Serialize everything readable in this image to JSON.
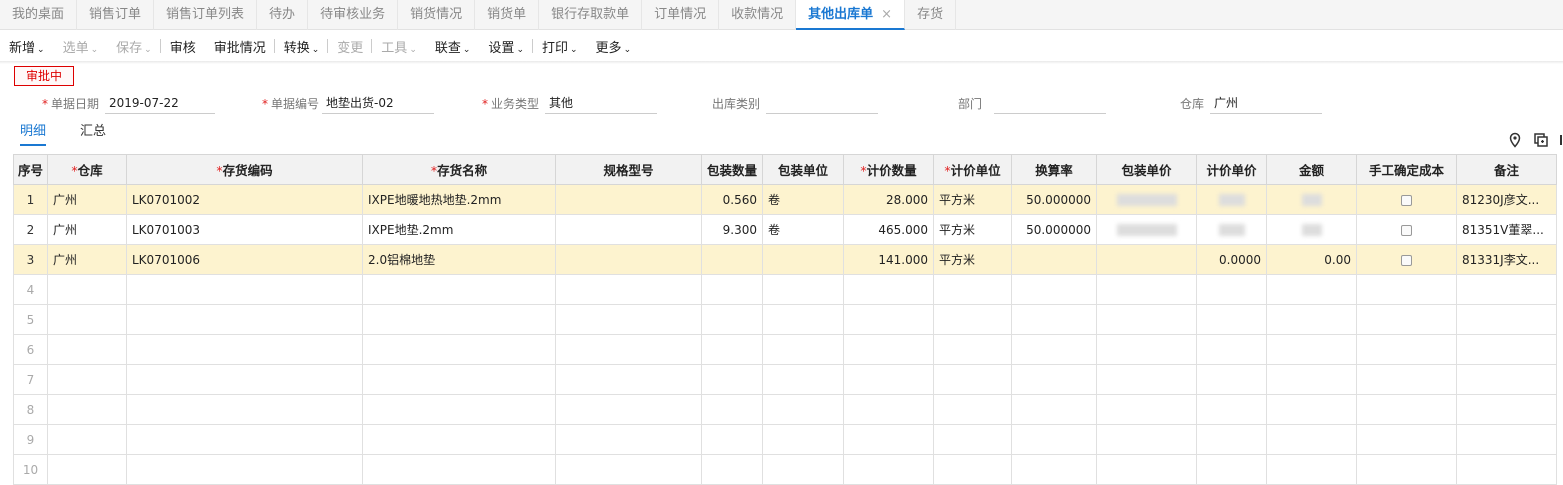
{
  "tabs": [
    {
      "label": "我的桌面"
    },
    {
      "label": "销售订单"
    },
    {
      "label": "销售订单列表"
    },
    {
      "label": "待办"
    },
    {
      "label": "待审核业务"
    },
    {
      "label": "销货情况"
    },
    {
      "label": "销货单"
    },
    {
      "label": "银行存取款单"
    },
    {
      "label": "订单情况"
    },
    {
      "label": "收款情况"
    },
    {
      "label": "其他出库单",
      "active": true,
      "close": "×"
    },
    {
      "label": "存货"
    }
  ],
  "toolbar": [
    {
      "label": "新增",
      "caret": "⌄",
      "disabled": false
    },
    {
      "label": "选单",
      "caret": "⌄",
      "disabled": true
    },
    {
      "label": "保存",
      "caret": "⌄",
      "disabled": true,
      "sep": true
    },
    {
      "label": "审核",
      "disabled": false
    },
    {
      "label": "审批情况",
      "disabled": false,
      "sep": true
    },
    {
      "label": "转换",
      "caret": "⌄",
      "disabled": false,
      "sep": true
    },
    {
      "label": "变更",
      "disabled": true,
      "sep": true
    },
    {
      "label": "工具",
      "caret": "⌄",
      "disabled": true
    },
    {
      "label": "联查",
      "caret": "⌄",
      "disabled": false
    },
    {
      "label": "设置",
      "caret": "⌄",
      "disabled": false,
      "sep": true
    },
    {
      "label": "打印",
      "caret": "⌄",
      "disabled": false
    },
    {
      "label": "更多",
      "caret": "⌄",
      "disabled": false
    }
  ],
  "status": "审批中",
  "form": {
    "date_label": "单据日期",
    "date_value": "2019-07-22",
    "code_label": "单据编号",
    "code_value": "地垫出货-02",
    "biz_label": "业务类型",
    "biz_value": "其他",
    "outtype_label": "出库类别",
    "outtype_value": "",
    "dept_label": "部门",
    "dept_value": "",
    "wh_label": "仓库",
    "wh_value": "广州"
  },
  "subtabs": {
    "detail": "明细",
    "summary": "汇总"
  },
  "table": {
    "headers": [
      "序号",
      "仓库",
      "存货编码",
      "存货名称",
      "规格型号",
      "包装数量",
      "包装单位",
      "计价数量",
      "计价单位",
      "换算率",
      "包装单价",
      "计价单价",
      "金额",
      "手工确定成本",
      "备注"
    ],
    "rows": [
      [
        "1",
        "广州",
        "LK0701002",
        "IXPE地暖地热地垫.2mm",
        "",
        "0.560",
        "卷",
        "28.000",
        "平方米",
        "50.000000",
        "",
        "",
        "",
        "",
        "81230J彦文..."
      ],
      [
        "2",
        "广州",
        "LK0701003",
        "IXPE地垫.2mm",
        "",
        "9.300",
        "卷",
        "465.000",
        "平方米",
        "50.000000",
        "",
        "",
        "",
        "",
        "81351V董翠..."
      ],
      [
        "3",
        "广州",
        "LK0701006",
        "2.0铝棉地垫",
        "",
        "",
        "",
        "141.000",
        "平方米",
        "",
        "",
        "0.0000",
        "0.00",
        "",
        "81331J李文..."
      ]
    ],
    "empty_rows": [
      "4",
      "5",
      "6",
      "7",
      "8",
      "9",
      "10"
    ]
  }
}
